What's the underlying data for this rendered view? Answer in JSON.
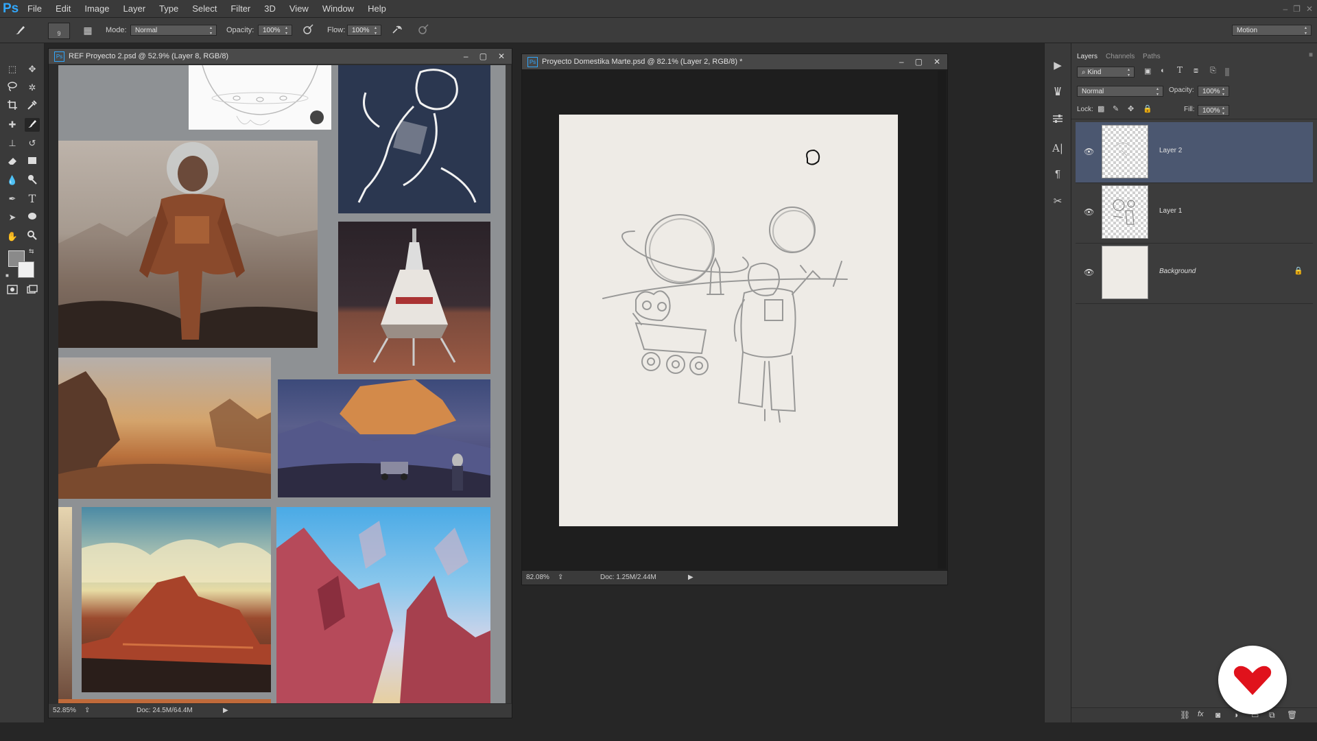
{
  "app": {
    "logo": "Ps",
    "menu": [
      "File",
      "Edit",
      "Image",
      "Layer",
      "Type",
      "Select",
      "Filter",
      "3D",
      "View",
      "Window",
      "Help"
    ],
    "window_controls": [
      "–",
      "❐",
      "✕"
    ]
  },
  "options_bar": {
    "brush_size": "9",
    "mode_label": "Mode:",
    "mode_value": "Normal",
    "opacity_label": "Opacity:",
    "opacity_value": "100%",
    "flow_label": "Flow:",
    "flow_value": "100%",
    "workspace_value": "Motion"
  },
  "tools": [
    "marquee-icon",
    "move-icon",
    "lasso-icon",
    "magic-wand-icon",
    "crop-icon",
    "eyedropper-icon",
    "healing-icon",
    "brush-icon",
    "stamp-icon",
    "history-brush-icon",
    "eraser-icon",
    "gradient-icon",
    "blur-icon",
    "dodge-icon",
    "pen-icon",
    "type-icon",
    "path-select-icon",
    "ellipse-icon",
    "hand-icon",
    "zoom-icon"
  ],
  "ref_doc": {
    "title": "REF Proyecto 2.psd @ 52.9% (Layer 8, RGB/8)",
    "zoom": "52.85%",
    "doc_size": "Doc: 24.5M/64.4M"
  },
  "main_doc": {
    "title": "Proyecto Domestika Marte.psd @ 82.1% (Layer 2, RGB/8) *",
    "zoom": "82.08%",
    "doc_size": "Doc: 1.25M/2.44M"
  },
  "layers_panel": {
    "tabs": [
      "Layers",
      "Channels",
      "Paths"
    ],
    "filter_value": "Kind",
    "blend_value": "Normal",
    "opacity_label": "Opacity:",
    "opacity_value": "100%",
    "lock_label": "Lock:",
    "fill_label": "Fill:",
    "fill_value": "100%",
    "layers": [
      {
        "name": "Layer 2",
        "selected": true
      },
      {
        "name": "Layer 1",
        "selected": false
      },
      {
        "name": "Background",
        "selected": false,
        "locked": true
      }
    ]
  },
  "colors": {
    "accent": "#31a8ff",
    "selection": "#4b5770",
    "badge": "#e0121c",
    "canvas": "#eeebe6"
  }
}
